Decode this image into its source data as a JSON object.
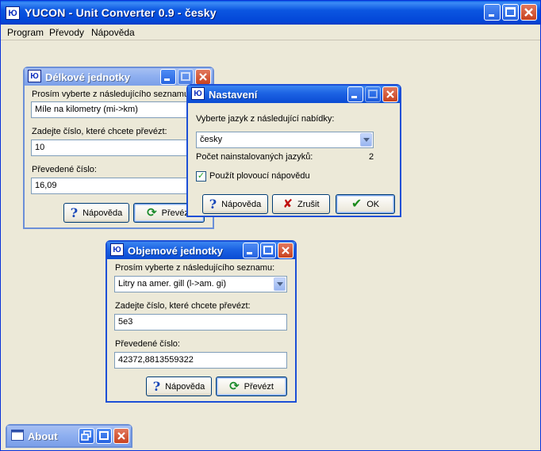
{
  "app": {
    "icon_text": "Ю",
    "title": "YUCON - Unit Converter 0.9 - česky"
  },
  "menu": {
    "items": [
      "Program",
      "Převody",
      "Nápověda"
    ]
  },
  "delkove": {
    "icon_text": "Ю",
    "title": "Délkové jednotky",
    "list_label": "Prosím vyberte z následujícího seznamu:",
    "conversion_value": "Míle na kilometry (mi->km)",
    "input_label": "Zadejte číslo, které chcete převézt:",
    "input_value": "10",
    "result_label": "Převedené číslo:",
    "result_value": "16,09",
    "help_button": "Nápověda",
    "convert_button": "Převézt"
  },
  "nastaveni": {
    "icon_text": "Ю",
    "title": "Nastavení",
    "language_label": "Vyberte jazyk z následující nabídky:",
    "language_value": "česky",
    "installed_label": "Počet nainstalovaných jazyků:",
    "installed_count": "2",
    "checkbox_label": "Použít plovoucí nápovědu",
    "checkbox_checked": true,
    "help_button": "Nápověda",
    "cancel_button": "Zrušit",
    "ok_button": "OK"
  },
  "objemove": {
    "icon_text": "Ю",
    "title": "Objemové jednotky",
    "list_label": "Prosím vyberte z následujícího seznamu:",
    "conversion_value": "Litry na amer. gill (l->am. gi)",
    "input_label": "Zadejte číslo, které chcete převézt:",
    "input_value": "5e3",
    "result_label": "Převedené číslo:",
    "result_value": "42372,8813559322",
    "help_button": "Nápověda",
    "convert_button": "Převézt"
  },
  "about": {
    "title": "About"
  }
}
